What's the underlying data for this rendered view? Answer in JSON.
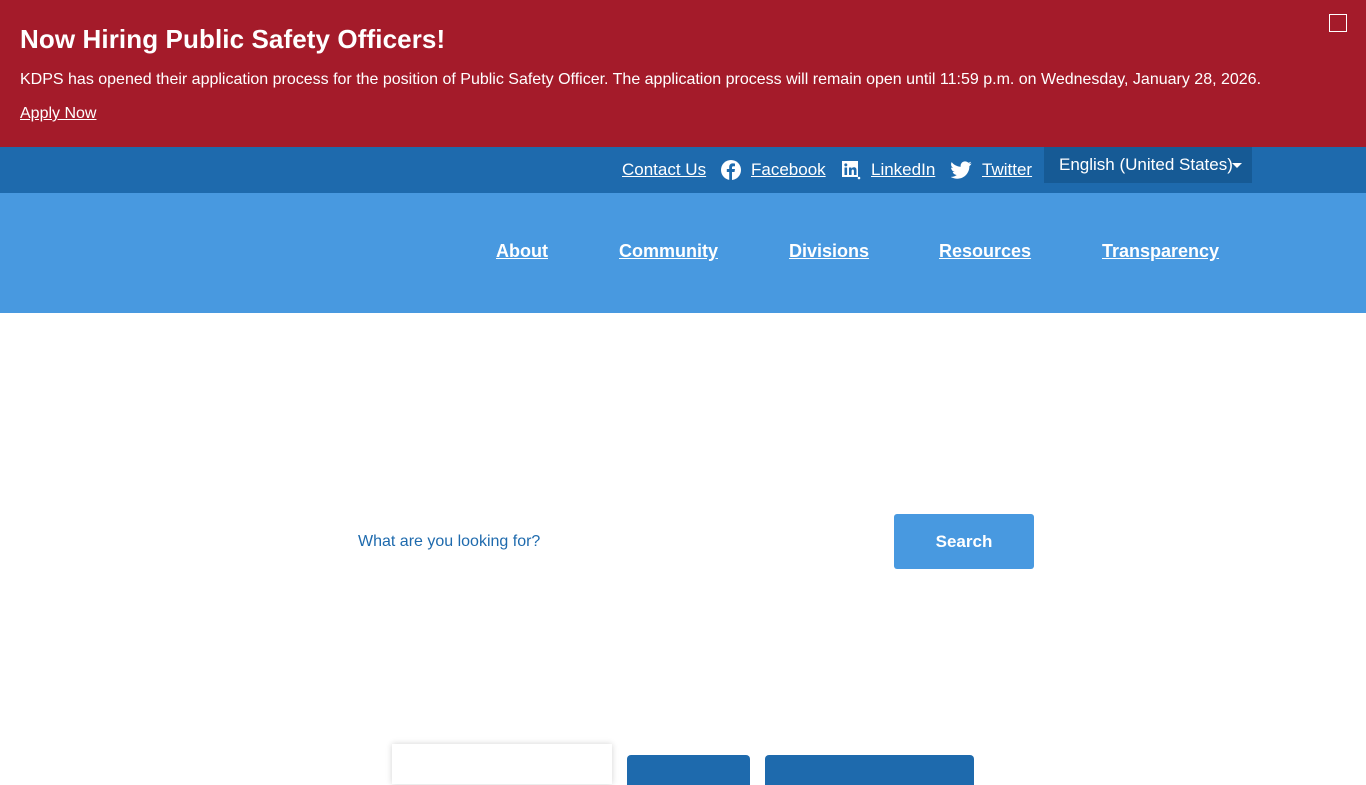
{
  "alert": {
    "title": "Now Hiring Public Safety Officers!",
    "body": "KDPS has opened their application process for the position of Public Safety Officer. The application process will remain open until 11:59 p.m. on Wednesday, January 28, 2026.",
    "link_label": "Apply Now",
    "close_icon": "close-box-icon",
    "background": "#a41b2a"
  },
  "utility": {
    "contact_label": "Contact Us",
    "facebook_label": "Facebook",
    "linkedin_label": "LinkedIn",
    "twitter_label": "Twitter",
    "language_selected": "English (United States)",
    "background": "#1e6aad"
  },
  "nav": {
    "items": [
      "About",
      "Community",
      "Divisions",
      "Resources",
      "Transparency"
    ],
    "background": "#4899e0"
  },
  "search": {
    "placeholder": "What are you looking for?",
    "button_label": "Search"
  }
}
